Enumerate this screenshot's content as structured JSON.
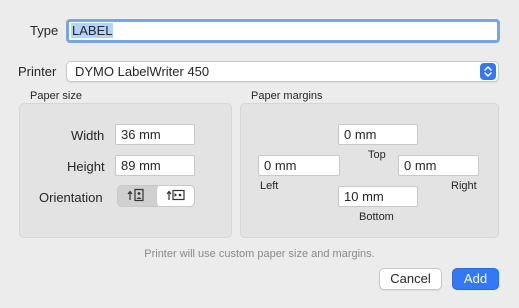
{
  "type": {
    "label": "Type",
    "value": "LABEL"
  },
  "printer": {
    "label": "Printer",
    "selected": "DYMO LabelWriter 450"
  },
  "paper_size": {
    "title": "Paper size",
    "width_label": "Width",
    "width_value": "36 mm",
    "height_label": "Height",
    "height_value": "89 mm",
    "orientation_label": "Orientation",
    "orientation_selected": "portrait"
  },
  "paper_margins": {
    "title": "Paper margins",
    "top_value": "0 mm",
    "top_label": "Top",
    "left_value": "0 mm",
    "left_label": "Left",
    "right_value": "0 mm",
    "right_label": "Right",
    "bottom_value": "10 mm",
    "bottom_label": "Bottom"
  },
  "info_text": "Printer will use custom paper size and margins.",
  "buttons": {
    "cancel": "Cancel",
    "add": "Add"
  },
  "colors": {
    "accent": "#3478f6",
    "focus_ring": "#74a7e8",
    "selection": "#b3d3f8",
    "window_bg": "#ececec",
    "group_bg": "#e3e3e3"
  }
}
